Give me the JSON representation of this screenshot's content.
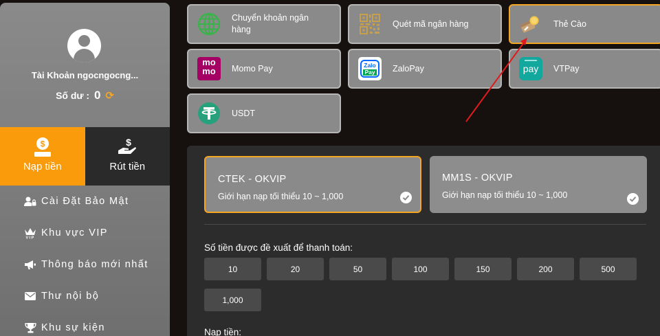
{
  "sidebar": {
    "account_name": "Tài Khoản ngocngocng...",
    "balance_label": "Số dư :",
    "balance_value": "0",
    "tabs": [
      {
        "label": "Nạp tiền",
        "active": true
      },
      {
        "label": "Rút tiền",
        "active": false
      }
    ],
    "menu": [
      {
        "label": "Cài Đặt Bảo Mật",
        "icon": "user-lock-icon"
      },
      {
        "label": "Khu vực VIP",
        "icon": "vip-crown-icon"
      },
      {
        "label": "Thông báo mới nhất",
        "icon": "megaphone-icon"
      },
      {
        "label": "Thư nội bộ",
        "icon": "envelope-icon"
      },
      {
        "label": "Khu sự kiện",
        "icon": "trophy-icon"
      }
    ]
  },
  "methods": [
    {
      "label": "Chuyển khoản ngân hàng",
      "icon": "globe-icon"
    },
    {
      "label": "Quét mã ngân hàng",
      "icon": "qr-code-icon"
    },
    {
      "label": "Thẻ Cào",
      "icon": "scratch-card-icon",
      "selected": true
    },
    {
      "label": "Momo Pay",
      "icon": "momo-logo",
      "logo_text": [
        "mo",
        "mo"
      ]
    },
    {
      "label": "ZaloPay",
      "icon": "zalopay-logo",
      "logo_text": [
        "Zalo",
        "Pay"
      ]
    },
    {
      "label": "VTPay",
      "icon": "vtpay-logo",
      "logo_text": "pay"
    },
    {
      "label": "USDT",
      "icon": "tether-icon"
    }
  ],
  "channels": [
    {
      "name": "CTEK - OKVIP",
      "limit": "Giới hạn nạp tối thiểu 10 ~ 1,000",
      "selected": true
    },
    {
      "name": "MM1S - OKVIP",
      "limit": "Giới hạn nạp tối thiểu 10 ~ 1,000",
      "selected": false
    }
  ],
  "amount_title": "Số tiền được đề xuất để thanh toán:",
  "amounts": [
    "10",
    "20",
    "50",
    "100",
    "150",
    "200",
    "500",
    "1,000"
  ],
  "deposit_label": "Nạp tiền:",
  "colors": {
    "accent": "#f99b0b",
    "selected_border": "#f5a623",
    "arrow": "#e01b1b"
  }
}
